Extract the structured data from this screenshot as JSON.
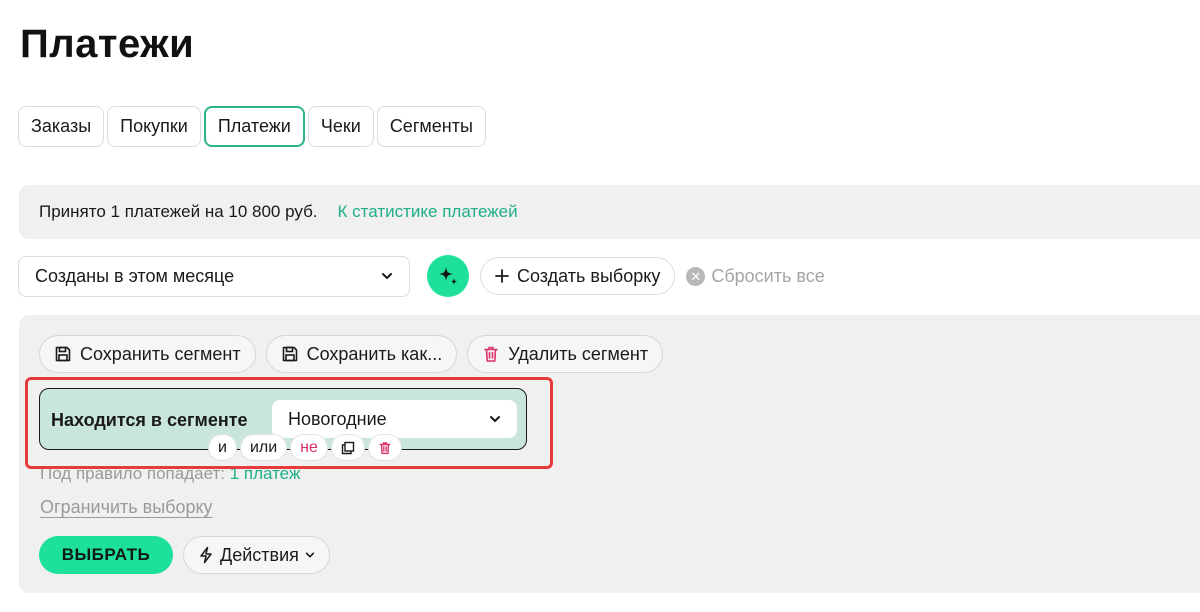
{
  "page": {
    "title": "Платежи"
  },
  "tabs": [
    {
      "label": "Заказы"
    },
    {
      "label": "Покупки"
    },
    {
      "label": "Платежи",
      "active": true
    },
    {
      "label": "Чеки"
    },
    {
      "label": "Сегменты"
    }
  ],
  "stats": {
    "text": "Принято 1 платежей на 10 800 руб.",
    "link": "К статистике платежей"
  },
  "filters": {
    "period_value": "Созданы в этом месяце",
    "create_label": "Создать выборку",
    "reset_label": "Сбросить все"
  },
  "segment_actions": {
    "save": "Сохранить сегмент",
    "save_as": "Сохранить как...",
    "delete": "Удалить сегмент"
  },
  "rule": {
    "label": "Находится в сегменте",
    "value": "Новогодние",
    "pills": {
      "and": "и",
      "or": "или",
      "not": "не"
    }
  },
  "matches": {
    "prefix": "Под правило попадает:",
    "count": "1 платеж"
  },
  "limit_label": "Ограничить выборку",
  "buttons": {
    "select": "ВЫБРАТЬ",
    "actions": "Действия"
  },
  "colors": {
    "accent": "#1de09a",
    "link": "#1fae86",
    "highlight": "#e53b3b",
    "rule_bg": "#c8e6dc",
    "danger": "#d8306a"
  }
}
